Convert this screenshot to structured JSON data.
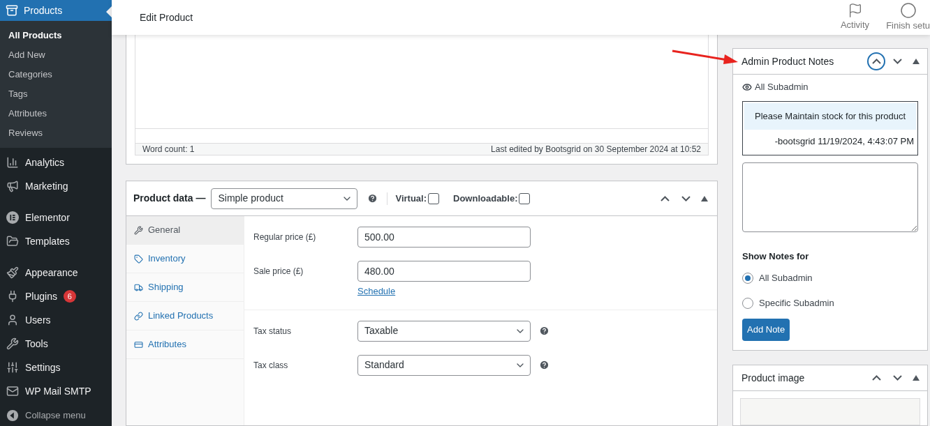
{
  "sidebar": {
    "current": {
      "label": "Products",
      "submenu": [
        {
          "label": "All Products",
          "selected": true
        },
        {
          "label": "Add New",
          "selected": false
        },
        {
          "label": "Categories",
          "selected": false
        },
        {
          "label": "Tags",
          "selected": false
        },
        {
          "label": "Attributes",
          "selected": false
        },
        {
          "label": "Reviews",
          "selected": false
        }
      ]
    },
    "groups": [
      [
        {
          "label": "Analytics"
        },
        {
          "label": "Marketing"
        }
      ],
      [
        {
          "label": "Elementor"
        },
        {
          "label": "Templates"
        }
      ],
      [
        {
          "label": "Appearance"
        },
        {
          "label": "Plugins",
          "badge": "6"
        },
        {
          "label": "Users"
        },
        {
          "label": "Tools"
        },
        {
          "label": "Settings"
        },
        {
          "label": "WP Mail SMTP"
        }
      ]
    ],
    "collapse": "Collapse menu"
  },
  "header": {
    "title": "Edit Product",
    "actions": [
      {
        "label": "Activity"
      },
      {
        "label": "Finish setu"
      }
    ]
  },
  "editor": {
    "word_count": "Word count: 1",
    "last_edited": "Last edited by Bootsgrid on 30 September 2024 at 10:52"
  },
  "product_data": {
    "title": "Product data —",
    "type": "Simple product",
    "options": [
      {
        "label": "Virtual:",
        "checked": false
      },
      {
        "label": "Downloadable:",
        "checked": false
      }
    ],
    "tabs": [
      {
        "label": "General",
        "selected": true
      },
      {
        "label": "Inventory",
        "selected": false
      },
      {
        "label": "Shipping",
        "selected": false
      },
      {
        "label": "Linked Products",
        "selected": false
      },
      {
        "label": "Attributes",
        "selected": false
      }
    ],
    "pricing": [
      {
        "label": "Regular price (£)",
        "value": "500.00"
      },
      {
        "label": "Sale price (£)",
        "value": "480.00"
      }
    ],
    "schedule_link": "Schedule",
    "tax": [
      {
        "label": "Tax status",
        "value": "Taxable"
      },
      {
        "label": "Tax class",
        "value": "Standard"
      }
    ]
  },
  "notes_box": {
    "title": "Admin Product Notes",
    "up_focused": true,
    "visibility": "All Subadmin",
    "note": {
      "text": "Please Maintain stock for this product",
      "meta": "-bootsgrid 11/19/2024, 4:43:07 PM"
    },
    "show_for_label": "Show Notes for",
    "show_for": [
      {
        "label": "All Subadmin",
        "selected": true
      },
      {
        "label": "Specific Subadmin",
        "selected": false
      }
    ],
    "button": "Add Note"
  },
  "image_box": {
    "title": "Product image"
  }
}
